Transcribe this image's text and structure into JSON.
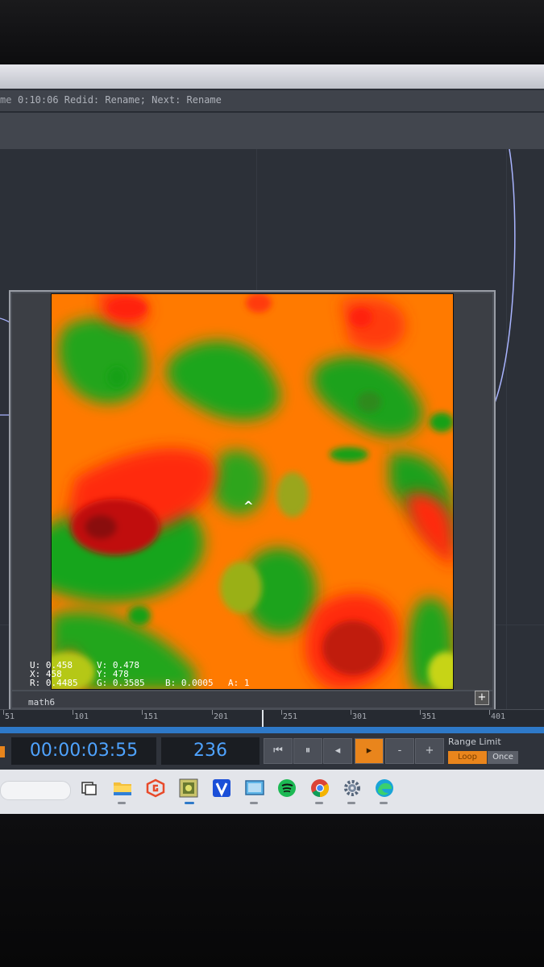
{
  "status_bar": {
    "prefix": "me",
    "text": "0:10:06 Redid: Rename; Next: Rename"
  },
  "node": {
    "name": "math6",
    "plus_icon": "+",
    "cursor": "^",
    "readout": {
      "u": "U: 0.458",
      "v": "V: 0.478",
      "x": "X: 458",
      "y": "Y: 478",
      "r": "R: 0.4485",
      "g": "G: 0.3585",
      "b": "B: 0.0005",
      "a": "A: 1"
    }
  },
  "timeline": {
    "ticks": [
      "51",
      "101",
      "151",
      "201",
      "251",
      "301",
      "351",
      "401"
    ]
  },
  "transport": {
    "timecode": "00:00:03:55",
    "frame": "236",
    "buttons": [
      "⏮",
      "⏸",
      "◂",
      "▸",
      "-",
      "+"
    ],
    "range_limit_label": "Range Limit",
    "loop_label": "Loop",
    "once_label": "Once"
  },
  "taskbar": {
    "icons": [
      "task-view-icon",
      "file-explorer-icon",
      "g-app-icon",
      "touchdesigner-icon",
      "v-app-icon",
      "photo-viewer-icon",
      "spotify-icon",
      "chrome-icon",
      "settings-icon",
      "edge-icon"
    ]
  },
  "colors": {
    "accent": "#e9851c",
    "timecode_blue": "#4fa3ff",
    "timeline_blue": "#2e79c8"
  }
}
